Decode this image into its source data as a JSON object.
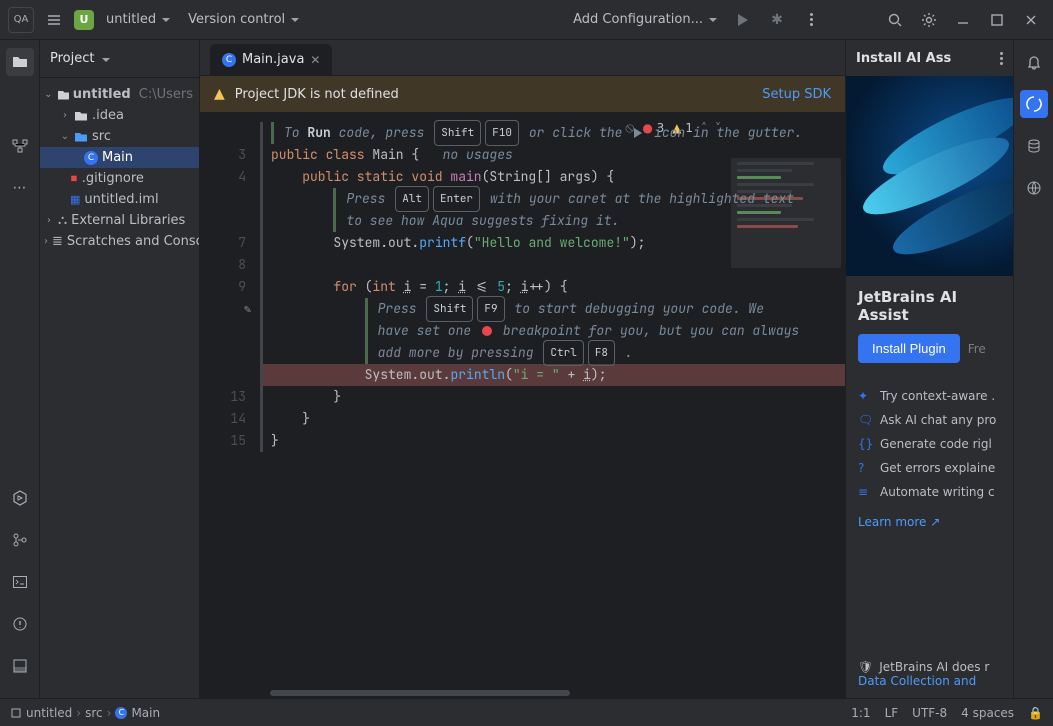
{
  "topbar": {
    "logo_badge": "QA",
    "project_badge": "U",
    "project_name": "untitled",
    "vcs_label": "Version control",
    "config_label": "Add Configuration..."
  },
  "project_panel": {
    "title": "Project",
    "root_name": "untitled",
    "root_path": "C:\\Users",
    "idea_folder": ".idea",
    "src_folder": "src",
    "main_file": "Main",
    "gitignore": ".gitignore",
    "iml": "untitled.iml",
    "external_libs": "External Libraries",
    "scratches": "Scratches and Consoles"
  },
  "tab": {
    "name": "Main.java"
  },
  "banner": {
    "text": "Project JDK is not defined",
    "action": "Setup SDK"
  },
  "inspections": {
    "errors": "3",
    "warnings": "1"
  },
  "hints": {
    "run_pre": "To ",
    "run_bold": "Run",
    "run_post": " code, press ",
    "run_key1": "Shift",
    "run_key2": "F10",
    "run_tail": " or click the ",
    "run_tail2": " icon in the gutter.",
    "no_usages": "no usages",
    "fix_pre": "Press ",
    "fix_k1": "Alt",
    "fix_k2": "Enter",
    "fix_mid": " with your caret at the highlighted text",
    "fix_line2": "to see how Aqua suggests fixing it.",
    "dbg_pre": "Press ",
    "dbg_k1": "Shift",
    "dbg_k2": "F9",
    "dbg_mid": " to start debugging your code. We",
    "dbg_l2a": "have set one ",
    "dbg_l2b": " breakpoint for you, but you can always",
    "dbg_l3a": "add more by pressing ",
    "dbg_k3": "Ctrl",
    "dbg_k4": "F8"
  },
  "code": {
    "l3": "public class Main {",
    "l4_a": "public static void ",
    "l4_main": "main",
    "l4_b": "(",
    "l4_str": "String",
    "l4_c": "[] args) {",
    "l7_a": "System",
    "l7_b": ".out.",
    "l7_fn": "printf",
    "l7_c": "(",
    "l7_s": "\"Hello and welcome!\"",
    "l7_d": ");",
    "l9_a": "for ",
    "l9_b": "(",
    "l9_int": "int ",
    "l9_i1": "i",
    "l9_c": " = ",
    "l9_n1": "1",
    "l9_d": "; ",
    "l9_i2": "i",
    "l9_e": " <= ",
    "l9_n2": "5",
    "l9_f": "; ",
    "l9_i3": "i",
    "l9_g": "++) {",
    "l12_a": "System",
    "l12_b": ".out.",
    "l12_fn": "println",
    "l12_c": "(",
    "l12_s": "\"i = \"",
    "l12_d": " + ",
    "l12_i": "i",
    "l12_e": ");",
    "l13": "}",
    "l14": "}",
    "l15": "}"
  },
  "lines": {
    "n3": "3",
    "n4": "4",
    "n7": "7",
    "n8": "8",
    "n9": "9",
    "n13": "13",
    "n14": "14",
    "n15": "15"
  },
  "ai": {
    "header": "Install AI Ass",
    "title": "JetBrains AI Assist",
    "install": "Install Plugin",
    "free": "Fre",
    "f1": "Try context-aware .",
    "f2": "Ask AI chat any pro",
    "f3": "Generate code rigl",
    "f4": "Get errors explaine",
    "f5": "Automate writing c",
    "learn": "Learn more ↗",
    "foot1": "JetBrains AI does r",
    "foot2": "Data Collection and"
  },
  "status": {
    "c1": "untitled",
    "c2": "src",
    "c3": "Main",
    "pos": "1:1",
    "lf": "LF",
    "enc": "UTF-8",
    "indent": "4 spaces"
  }
}
